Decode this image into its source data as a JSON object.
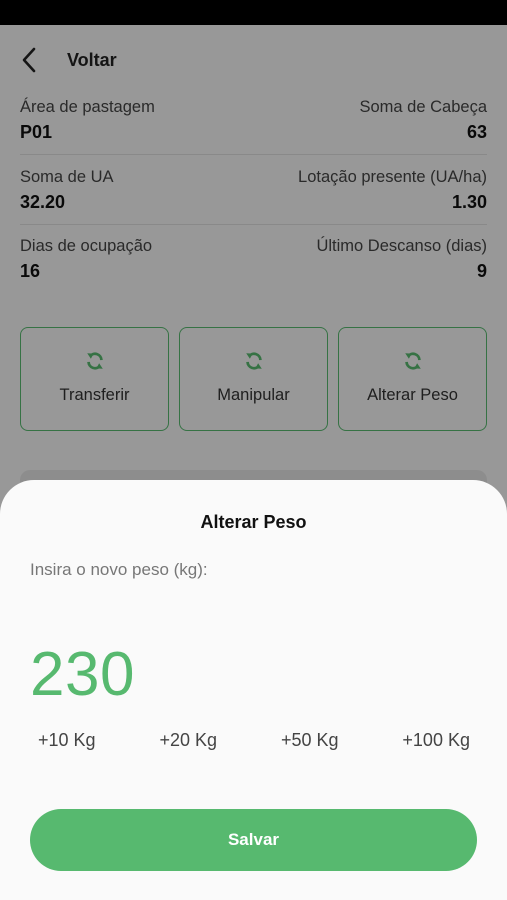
{
  "header": {
    "back_label": "Voltar"
  },
  "info": [
    {
      "left_label": "Área de pastagem",
      "left_value": "P01",
      "right_label": "Soma de Cabeça",
      "right_value": "63"
    },
    {
      "left_label": "Soma de UA",
      "left_value": "32.20",
      "right_label": "Lotação presente (UA/ha)",
      "right_value": "1.30"
    },
    {
      "left_label": "Dias de ocupação",
      "left_value": "16",
      "right_label": "Último Descanso (dias)",
      "right_value": "9"
    }
  ],
  "actions": [
    {
      "label": "Transferir",
      "icon": "refresh-icon"
    },
    {
      "label": "Manipular",
      "icon": "refresh-icon"
    },
    {
      "label": "Alterar Peso",
      "icon": "refresh-icon"
    }
  ],
  "modal": {
    "title": "Alterar Peso",
    "prompt": "Insira o novo peso (kg):",
    "value": "230",
    "increments": [
      "+10 Kg",
      "+20 Kg",
      "+50 Kg",
      "+100 Kg"
    ],
    "save_label": "Salvar"
  },
  "colors": {
    "accent": "#57b96f",
    "overlay": "rgba(0,0,0,0.38)"
  }
}
